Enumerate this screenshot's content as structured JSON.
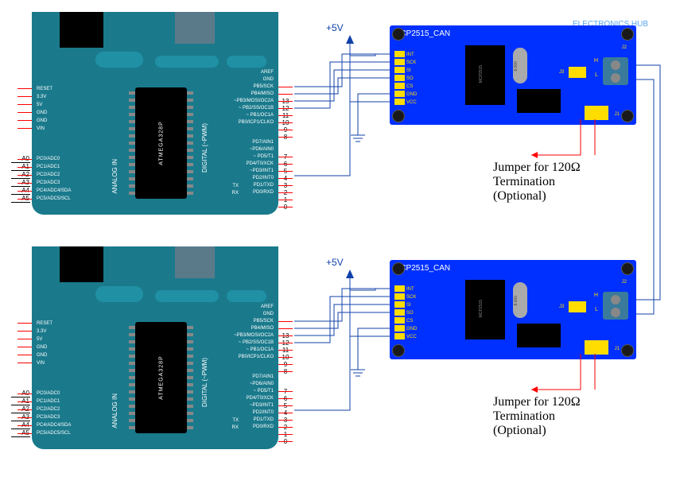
{
  "watermark": "ELECTRONICS HUB",
  "arduino": {
    "chip": "ATMEGA328P",
    "side_labels": {
      "analog": "ANALOG IN",
      "digital": "DIGITAL (~PWM)"
    },
    "right_pins_top": [
      "AREF",
      "GND",
      "PB5/SCK",
      "PB4/MISO",
      "~PB3/MOSI/OC2A",
      "~ PB2/SS/OC1B",
      "~ PB1/OC1A",
      "PB0/ICP1/CLKO"
    ],
    "right_nums_top": [
      "",
      "",
      "13",
      "12",
      "11",
      "10",
      "9",
      "8"
    ],
    "right_pins_bot": [
      "PD7/AIN1",
      "~PD6/AIN0",
      "~ PD5/T1",
      "PD4/T0/XCK",
      "~PD3/INT1",
      "PD2/INT0",
      "PD1/TXD",
      "PD0/RXD"
    ],
    "right_nums_bot": [
      "7",
      "6",
      "5",
      "4",
      "3",
      "2",
      "1",
      "0"
    ],
    "tx_rx": [
      "TX",
      "RX"
    ],
    "power_pins": [
      "RESET",
      "3.3V",
      "5V",
      "GND",
      "GND",
      "VIN"
    ],
    "analog_pins": [
      "PC0/ADC0",
      "PC1/ADC1",
      "PC2/ADC2",
      "PC3/ADC3",
      "PC4/ADC4/SDA",
      "PC5/ADC5/SCL"
    ],
    "analog_ext": [
      "A0",
      "A1",
      "A2",
      "A3",
      "A4",
      "A5"
    ]
  },
  "can": {
    "title": "MCP2515_CAN",
    "pins": [
      "INT",
      "SCK",
      "SI",
      "SO",
      "CS",
      "GND",
      "VCC"
    ],
    "ic1": "MCP2515",
    "crystal": "8.000",
    "jumpers": {
      "j1": "J1",
      "j2": "J2",
      "j3": "J3"
    },
    "bus": {
      "h": "H",
      "l": "L"
    }
  },
  "power": {
    "vcc_label": "+5V"
  },
  "note": {
    "line1": "Jumper for 120Ω",
    "line2": "Termination",
    "line3": "(Optional)"
  },
  "chart_data": {
    "type": "wiring-diagram",
    "nodes": [
      {
        "id": "arduino_1",
        "type": "Arduino UNO (ATMEGA328P)"
      },
      {
        "id": "arduino_2",
        "type": "Arduino UNO (ATMEGA328P)"
      },
      {
        "id": "can_1",
        "type": "MCP2515_CAN module"
      },
      {
        "id": "can_2",
        "type": "MCP2515_CAN module"
      }
    ],
    "spi_connections": [
      {
        "from": "arduino_1.D13",
        "to": "can_1.SCK"
      },
      {
        "from": "arduino_1.D12",
        "to": "can_1.SO"
      },
      {
        "from": "arduino_1.D11",
        "to": "can_1.SI"
      },
      {
        "from": "arduino_1.D10",
        "to": "can_1.CS"
      },
      {
        "from": "arduino_1.D2",
        "to": "can_1.INT"
      },
      {
        "from": "arduino_2.D13",
        "to": "can_2.SCK"
      },
      {
        "from": "arduino_2.D12",
        "to": "can_2.SO"
      },
      {
        "from": "arduino_2.D11",
        "to": "can_2.SI"
      },
      {
        "from": "arduino_2.D10",
        "to": "can_2.CS"
      },
      {
        "from": "arduino_2.D2",
        "to": "can_2.INT"
      }
    ],
    "power_connections": [
      {
        "node": "can_1.VCC",
        "rail": "+5V"
      },
      {
        "node": "can_1.GND",
        "rail": "GND"
      },
      {
        "node": "can_2.VCC",
        "rail": "+5V"
      },
      {
        "node": "can_2.GND",
        "rail": "GND"
      }
    ],
    "can_bus": [
      {
        "from": "can_1.H",
        "to": "can_2.H"
      },
      {
        "from": "can_1.L",
        "to": "can_2.L"
      }
    ],
    "termination": {
      "resistor_ohms": 120,
      "via_jumper": "J1",
      "note": "Optional"
    }
  }
}
